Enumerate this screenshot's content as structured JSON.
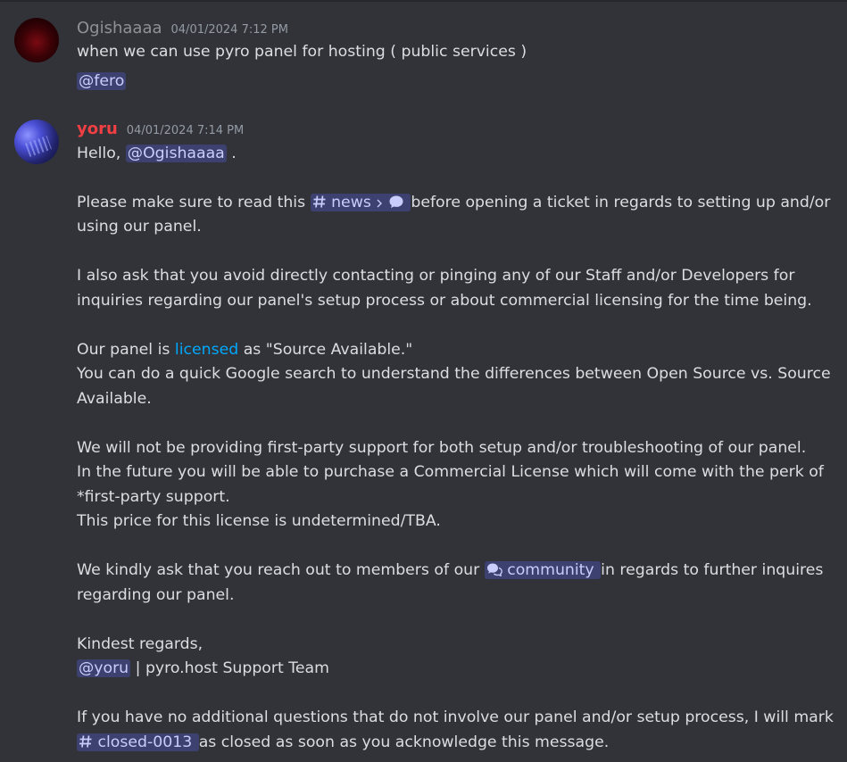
{
  "messages": [
    {
      "username": "Ogishaaaa",
      "timestamp": "04/01/2024 7:12 PM",
      "text": "when we can use pyro panel for hosting ( public services )",
      "mention": "@fero"
    },
    {
      "username": "yoru",
      "timestamp": "04/01/2024 7:14 PM",
      "greeting": "Hello,",
      "greeting_mention": "@Ogishaaaa",
      "greeting_end": ".",
      "p1_a": "Please make sure to read this",
      "p1_channel": "news",
      "p1_b": "before opening a ticket in regards to setting up and/or",
      "p1_c": "using our panel.",
      "p2_a": "I also ask that you avoid directly contacting or pinging any of our Staff and/or Developers for",
      "p2_b": "inquiries regarding our panel's setup process or about commercial licensing for the time being.",
      "p3_a": "Our panel is",
      "p3_link": "licensed",
      "p3_b": "as \"Source Available.\"",
      "p3_c": "You can do a quick Google search to understand the differences between Open Source vs. Source",
      "p3_d": "Available.",
      "p4_a": "We will not be providing first-party support for both setup and/or troubleshooting of our panel.",
      "p4_b": "In the future you will be able to purchase a Commercial License which will come with the perk of",
      "p4_c": "*first-party support.",
      "p4_d": "This price for this license is undetermined/TBA.",
      "p5_a": "We kindly ask that you reach out to members of our",
      "p5_channel": "community",
      "p5_b": "in regards to further inquires",
      "p5_c": "regarding our panel.",
      "p6_a": "Kindest regards,",
      "p6_mention": "@yoru",
      "p6_b": "| pyro.host Support Team",
      "p7_a": "If you have no additional questions that do not involve our panel and/or setup process, I will mark",
      "p7_channel": "closed-0013",
      "p7_b": "as closed as soon as you acknowledge this message."
    }
  ]
}
